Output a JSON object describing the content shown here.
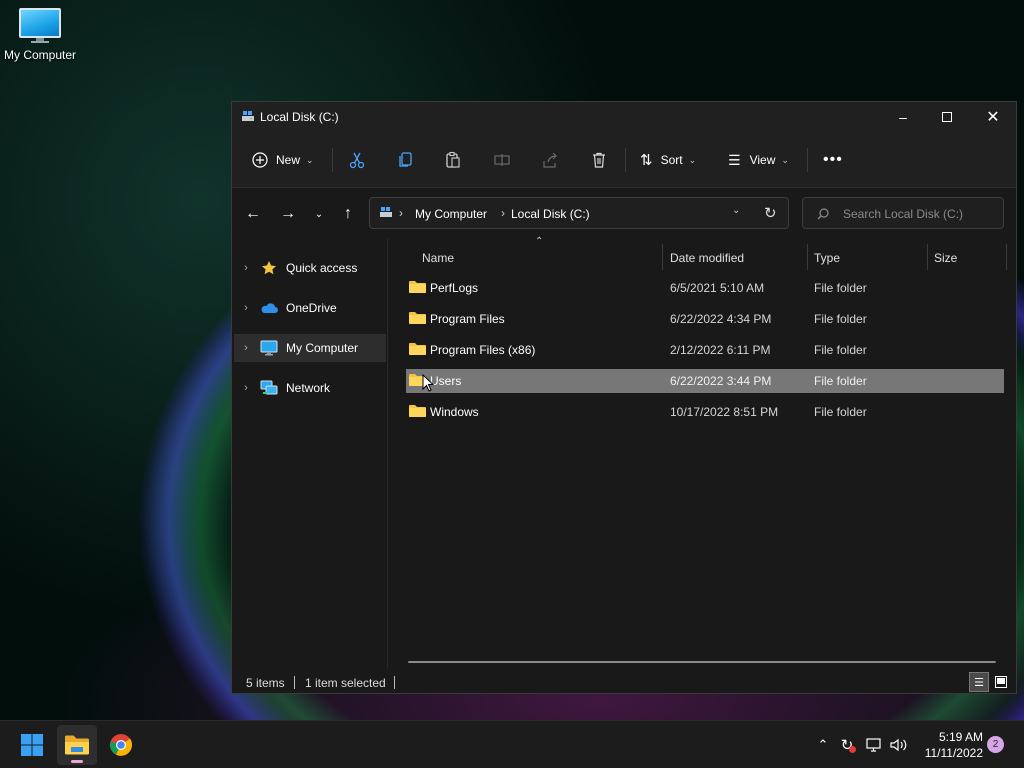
{
  "desktop": {
    "icons": [
      {
        "label": "My Computer",
        "icon": "monitor-icon"
      }
    ]
  },
  "window": {
    "title": "Local Disk (C:)",
    "controls": {
      "minimize": "minimize-icon",
      "maximize": "maximize-icon",
      "close": "close-icon"
    }
  },
  "toolbar": {
    "new_label": "New",
    "sort_label": "Sort",
    "view_label": "View",
    "icons": [
      "cut-icon",
      "copy-icon",
      "paste-icon",
      "rename-icon",
      "share-icon",
      "delete-icon",
      "more-icon"
    ]
  },
  "navigation": {
    "breadcrumb": [
      "My Computer",
      "Local Disk (C:)"
    ],
    "search_placeholder": "Search Local Disk (C:)"
  },
  "sidebar": {
    "items": [
      {
        "label": "Quick access",
        "icon": "star-icon",
        "selected": false
      },
      {
        "label": "OneDrive",
        "icon": "cloud-icon",
        "selected": false
      },
      {
        "label": "My Computer",
        "icon": "monitor-icon",
        "selected": true
      },
      {
        "label": "Network",
        "icon": "network-icon",
        "selected": false
      }
    ]
  },
  "table": {
    "columns": [
      "Name",
      "Date modified",
      "Type",
      "Size"
    ],
    "rows": [
      {
        "name": "PerfLogs",
        "date": "6/5/2021 5:10 AM",
        "type": "File folder",
        "size": "",
        "selected": false
      },
      {
        "name": "Program Files",
        "date": "6/22/2022 4:34 PM",
        "type": "File folder",
        "size": "",
        "selected": false
      },
      {
        "name": "Program Files (x86)",
        "date": "2/12/2022 6:11 PM",
        "type": "File folder",
        "size": "",
        "selected": false
      },
      {
        "name": "Users",
        "date": "6/22/2022 3:44 PM",
        "type": "File folder",
        "size": "",
        "selected": true
      },
      {
        "name": "Windows",
        "date": "10/17/2022 8:51 PM",
        "type": "File folder",
        "size": "",
        "selected": false
      }
    ]
  },
  "status": {
    "item_count": "5 items",
    "selection": "1 item selected"
  },
  "taskbar": {
    "apps": [
      "start-icon",
      "file-explorer-icon",
      "chrome-icon"
    ],
    "time": "5:19 AM",
    "date": "11/11/2022",
    "notification_count": "2"
  },
  "colors": {
    "folder": "#f3c440",
    "accent_blue": "#4aa3ff",
    "selection_row": "#777777"
  }
}
